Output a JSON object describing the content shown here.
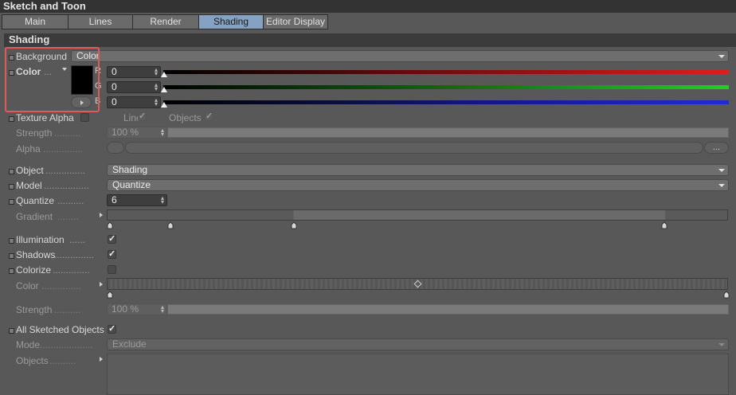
{
  "window": {
    "title": "Sketch and Toon"
  },
  "tabs": [
    {
      "label": "Main"
    },
    {
      "label": "Lines"
    },
    {
      "label": "Render"
    },
    {
      "label": "Shading",
      "active": true
    },
    {
      "label": "Editor Display"
    }
  ],
  "section": {
    "title": "Shading"
  },
  "background": {
    "label": "Background",
    "value": "Color"
  },
  "color": {
    "label": "Color",
    "dots": "...",
    "swatch_hex": "#000000",
    "channels": [
      {
        "name": "R",
        "value": "0",
        "bar_color": "#e41b1b"
      },
      {
        "name": "G",
        "value": "0",
        "bar_color": "#20d020"
      },
      {
        "name": "B",
        "value": "0",
        "bar_color": "#1f2bdc"
      }
    ]
  },
  "texture_alpha": {
    "label": "Texture Alpha",
    "lines_label": "Lines",
    "lines_checked": true,
    "objects_label": "Objects",
    "objects_checked": true
  },
  "strength1": {
    "label": "Strength",
    "dots": "..........",
    "value": "100 %"
  },
  "alpha": {
    "label": "Alpha",
    "dots": "...............",
    "button": "..."
  },
  "object": {
    "label": "Object",
    "dots": "...............",
    "value": "Shading"
  },
  "model": {
    "label": "Model",
    "dots": ".................",
    "value": "Quantize"
  },
  "quantize": {
    "label": "Quantize",
    "dots": "..........",
    "value": "6"
  },
  "gradient": {
    "label": "Gradient",
    "dots": "........"
  },
  "illumination": {
    "label": "Illumination",
    "dots": "......",
    "checked": true
  },
  "shadows": {
    "label": "Shadows",
    "dots": "...............",
    "checked": true
  },
  "colorize": {
    "label": "Colorize",
    "dots": "..............",
    "checked": false
  },
  "color2": {
    "label": "Color",
    "dots": "..............."
  },
  "strength2": {
    "label": "Strength",
    "dots": "..........",
    "value": "100 %"
  },
  "all_sketched": {
    "label": "All Sketched Objects",
    "checked": true
  },
  "mode": {
    "label": "Mode",
    "dots": "....................",
    "value": "Exclude"
  },
  "objects": {
    "label": "Objects",
    "dots": ".........."
  },
  "colors": {
    "accent_tab": "#86a2c2",
    "highlight": "#e05a5a",
    "panel_bg": "#585858"
  }
}
